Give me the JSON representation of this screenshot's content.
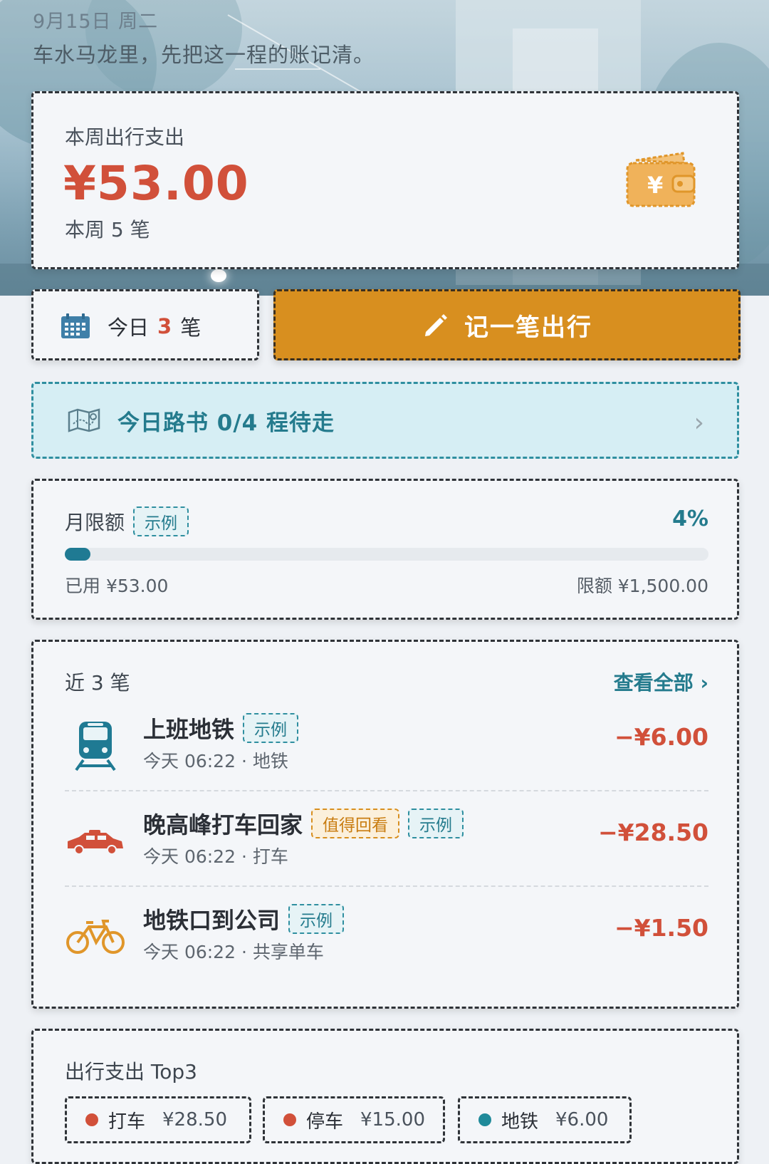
{
  "header": {
    "date": "9月15日 周二",
    "slogan": "车水马龙里，先把这一程的账记清。"
  },
  "week": {
    "label": "本周出行支出",
    "amount": "¥53.00",
    "count_text": "本周 5 笔"
  },
  "today": {
    "prefix": "今日",
    "count": "3",
    "suffix": "笔"
  },
  "record_button": {
    "label": "记一笔出行"
  },
  "roadbook": {
    "text": "今日路书 0/4 程待走"
  },
  "limit": {
    "title": "月限额",
    "tag": "示例",
    "percent_text": "4%",
    "progress": 0.04,
    "used": "已用 ¥53.00",
    "quota": "限额 ¥1,500.00"
  },
  "recent": {
    "title": "近 3 笔",
    "view_all": "查看全部 ›",
    "items": [
      {
        "name": "上班地铁",
        "tags": [
          "示例"
        ],
        "meta": "今天 06:22 · 地铁",
        "amount": "−¥6.00",
        "icon": "subway-icon",
        "icon_color": "#1f7a93"
      },
      {
        "name": "晚高峰打车回家",
        "tag_gold": "值得回看",
        "tags": [
          "示例"
        ],
        "meta": "今天 06:22 · 打车",
        "amount": "−¥28.50",
        "icon": "taxi-icon",
        "icon_color": "#d1503a"
      },
      {
        "name": "地铁口到公司",
        "tags": [
          "示例"
        ],
        "meta": "今天 06:22 · 共享单车",
        "amount": "−¥1.50",
        "icon": "bicycle-icon",
        "icon_color": "#e0962a"
      }
    ]
  },
  "top3": {
    "title": "出行支出 Top3",
    "items": [
      {
        "name": "打车",
        "value": "¥28.50",
        "color": "#d1503a"
      },
      {
        "name": "停车",
        "value": "¥15.00",
        "color": "#d1503a"
      },
      {
        "name": "地铁",
        "value": "¥6.00",
        "color": "#1f8a9a"
      }
    ]
  },
  "colors": {
    "accent": "#d88f1f",
    "expense": "#d1503a",
    "teal": "#247b8d"
  }
}
